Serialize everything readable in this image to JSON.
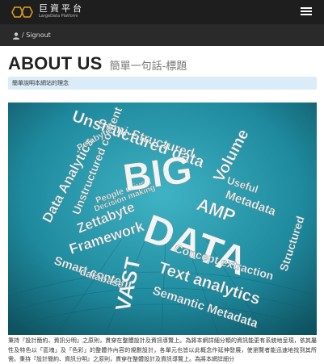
{
  "header": {
    "brand_name": "巨資平台",
    "brand_sub": "LargeData Platform",
    "logo_icon": "hexagon-logo-icon",
    "menu_icon": "hamburger-icon",
    "bar_color": "#1e1e1e",
    "logo_color": "#e0a020"
  },
  "subbar": {
    "user_icon": "user-icon",
    "signout_label": "/ Signout"
  },
  "page": {
    "title": "ABOUT US",
    "subtitle": "簡單一句話-標題",
    "callout": "簡單說明本網站的理念",
    "paragraph": "秉持『設計簡約、資訊分明』之原則，貫穿在整體設計及資訊導覽上。為將本網詳細分類的資訊能更有系統地呈現，依其屬性及特色以「區塊」及「色彩」的整體作內容的規劃設計，各單元也皆以此概念作延伸發展，使瀏覽者能迅速地找到其所需。秉持『設計簡約、資訊分明』之原則，貫穿在整體設計及資訊導覽上。為將本網詳細分"
  },
  "hero": {
    "background_color": "#1f8a9e",
    "words": [
      "Semi-Structured",
      "Unstructured data",
      "Data Analytics",
      "Unstructured content",
      "Petabyte",
      "People driven",
      "Decision making",
      "Zettabyte",
      "Framework",
      "Smart content",
      "database",
      "BIG",
      "DATA",
      "Volume",
      "Useful",
      "Metadata",
      "AMP",
      "Structured",
      "Concept extraction",
      "Text analytics",
      "Semantic Metadata",
      "VAST"
    ]
  }
}
